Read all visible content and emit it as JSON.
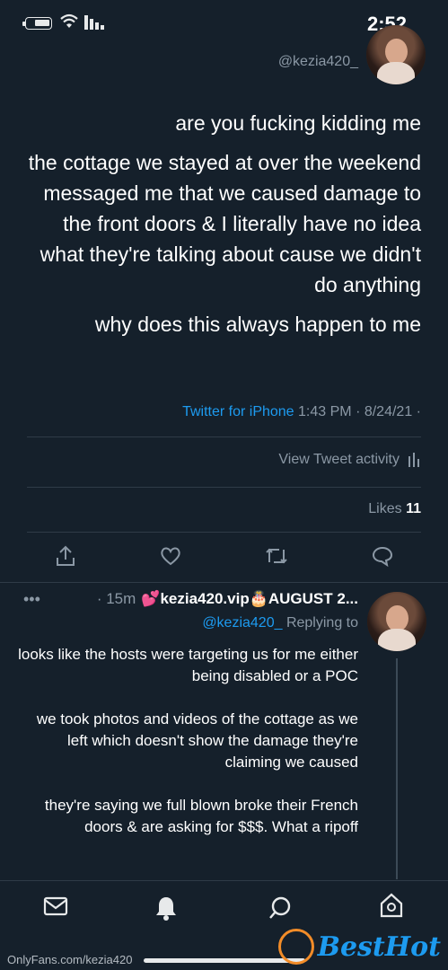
{
  "status_bar": {
    "time": "2:52"
  },
  "tweet": {
    "handle": "@kezia420_",
    "paragraphs": [
      "are you fucking kidding me",
      "the cottage we stayed at over the weekend messaged me that we caused damage to the front doors & I literally have no idea what they're talking about cause we didn't do anything",
      "why does this always happen to me"
    ],
    "time": "1:43 PM · 8/24/21 ·",
    "source": "Twitter for iPhone",
    "activity_label": "View Tweet activity",
    "likes_count": "11",
    "likes_label": "Likes"
  },
  "reply": {
    "name": "💕kezia420.vip🎂AUGUST 2...",
    "time": "· 15m",
    "more": "•••",
    "replying_prefix": "Replying to",
    "replying_handle": "@kezia420_",
    "paragraphs": [
      "looks like the hosts were targeting us for me either being disabled or a POC",
      "we took photos and videos of the cottage as we left which doesn't show the damage they're claiming we caused",
      "they're saying we full blown broke their French doors & are asking for $$$. What a ripoff"
    ]
  },
  "watermark": {
    "text": "OnlyFans.com/kezia420",
    "logo": "BestHot"
  },
  "colors": {
    "background": "#15202b",
    "accent": "#1d9bf0",
    "muted": "#8b98a5"
  }
}
